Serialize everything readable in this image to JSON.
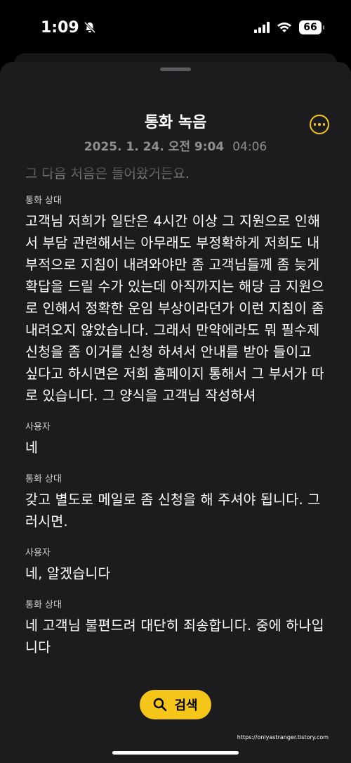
{
  "status_bar": {
    "time": "1:09",
    "battery": "66"
  },
  "header": {
    "title": "통화 녹음",
    "date": "2025. 1. 24. 오전 9:04",
    "duration": "04:06"
  },
  "transcript": {
    "partial_top": "그 다음 처음은 들어왔거든요.",
    "entries": [
      {
        "speaker": "통화 상대",
        "text": "고객님 저희가 일단은 4시간 이상 그 지원으로 인해서 부담 관련해서는 아무래도 부정확하게 저희도 내부적으로 지침이 내려와야만 좀 고객님들께 좀 늦게 확답을 드릴 수가 있는데 아직까지는 해당 금 지원으로 인해서 정확한 운임 부상이라던가 이런 지침이 좀 내려오지 않았습니다. 그래서 만약에라도 뭐 필수제 신청을 좀 이거를 신청 하셔서 안내를 받아 들이고 싶다고 하시면은 저희 홈페이지 통해서 그 부서가 따로 있습니다. 그 양식을 고객님 작성하셔"
      },
      {
        "speaker": "사용자",
        "text": "네"
      },
      {
        "speaker": "통화 상대",
        "text": "갖고 별도로 메일로 좀 신청을 해 주셔야 됩니다. 그러시면."
      },
      {
        "speaker": "사용자",
        "text": "네, 알겠습니다"
      },
      {
        "speaker": "통화 상대",
        "text": "네 고객님 불편드려 대단히 죄송합니다. 중에 하나입니다"
      }
    ]
  },
  "search_button": {
    "label": "검색"
  },
  "watermark": "https://onlyastranger.tistory.com",
  "colors": {
    "accent": "#f5c518",
    "sheet_background": "#1c1c1e"
  }
}
